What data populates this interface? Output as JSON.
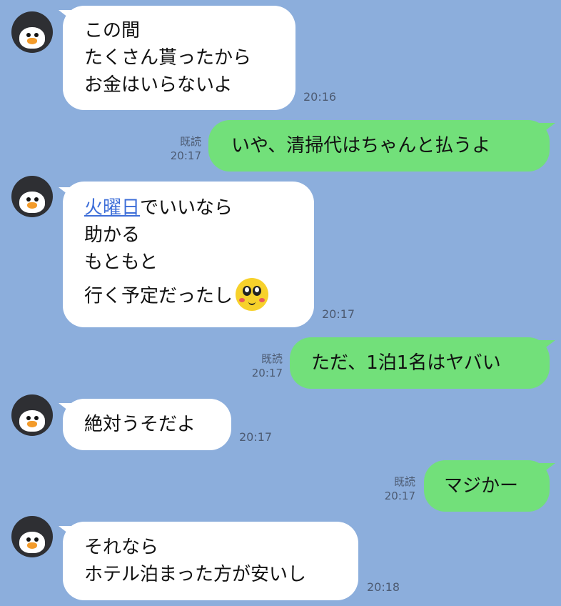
{
  "messages": [
    {
      "side": "left",
      "lines": [
        "この間",
        "たくさん貰ったから",
        "お金はいらないよ"
      ],
      "time": "20:16"
    },
    {
      "side": "right",
      "lines": [
        "いや、清掃代はちゃんと払うよ"
      ],
      "read": "既読",
      "time": "20:17"
    },
    {
      "side": "left",
      "link_text": "火曜日",
      "line1_rest": "でいいなら",
      "lines_mid": [
        "助かる",
        "もともと"
      ],
      "line_last": "行く予定だったし",
      "emoji": "smiling-face-emoji",
      "time": "20:17"
    },
    {
      "side": "right",
      "lines": [
        "ただ、1泊1名はヤバい"
      ],
      "read": "既読",
      "time": "20:17"
    },
    {
      "side": "left",
      "lines": [
        "絶対うそだよ"
      ],
      "time": "20:17"
    },
    {
      "side": "right",
      "lines": [
        "マジかー"
      ],
      "read": "既読",
      "time": "20:17"
    },
    {
      "side": "left",
      "lines": [
        "それなら",
        "ホテル泊まった方が安いし"
      ],
      "time": "20:18"
    }
  ],
  "avatar_icon": "penguin-icon",
  "colors": {
    "background": "#8caedc",
    "incoming": "#ffffff",
    "outgoing": "#72e07a",
    "link": "#3d6ed8"
  }
}
